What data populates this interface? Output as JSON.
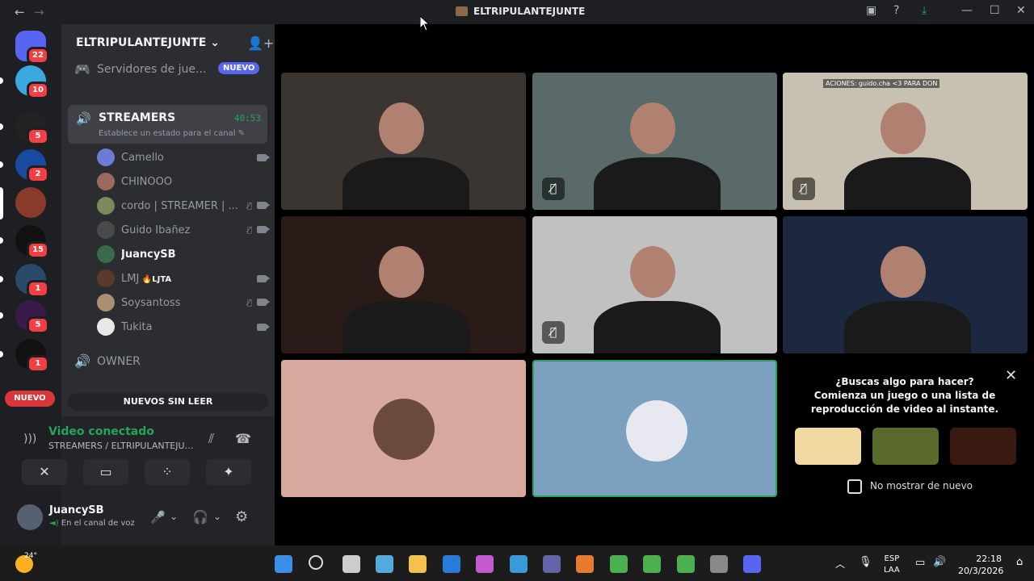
{
  "window": {
    "title": "ELTRIPULANTEJUNTE"
  },
  "rail": {
    "servers": [
      {
        "name": "discord-home",
        "badge": "22"
      },
      {
        "name": "server-2",
        "badge": "10"
      },
      {
        "name": "server-3",
        "badge": "5"
      },
      {
        "name": "server-4",
        "badge": "2"
      },
      {
        "name": "server-5",
        "badge": ""
      },
      {
        "name": "server-6",
        "badge": "15"
      },
      {
        "name": "server-7",
        "badge": "1"
      },
      {
        "name": "server-8",
        "badge": "5"
      },
      {
        "name": "server-9",
        "badge": "1"
      }
    ],
    "nuevo_label": "NUEVO"
  },
  "sidebar": {
    "guild_name": "ELTRIPULANTEJUNTE",
    "channel_servidores": "Servidores de jue...",
    "new_tag": "NUEVO",
    "active_channel": {
      "name": "STREAMERS",
      "timer": "40:53",
      "status": "Establece un estado para el canal"
    },
    "members": [
      {
        "name": "Camello",
        "tag": "",
        "muted": false,
        "video": true,
        "color": "#6b7bd6"
      },
      {
        "name": "CHINOOO",
        "tag": "",
        "muted": false,
        "video": false,
        "color": "#9a6b5d"
      },
      {
        "name": "cordo | STREAMER | ...",
        "tag": "",
        "muted": true,
        "video": true,
        "color": "#7a8a5a"
      },
      {
        "name": "Guido Ibañez",
        "tag": "",
        "muted": true,
        "video": true,
        "color": "#4a4a4a"
      },
      {
        "name": "JuancySB",
        "tag": "",
        "muted": false,
        "video": false,
        "color": "#3a6a4a"
      },
      {
        "name": "LMJ",
        "tag": "LJTA",
        "muted": false,
        "video": true,
        "color": "#5a3a2a"
      },
      {
        "name": "Soysantoss",
        "tag": "",
        "muted": true,
        "video": true,
        "color": "#a89070"
      },
      {
        "name": "Tukita",
        "tag": "",
        "muted": false,
        "video": true,
        "color": "#e8e8e8"
      }
    ],
    "channel_owner": "OWNER",
    "unread_label": "NUEVOS SIN LEER"
  },
  "voice": {
    "connected": "Video conectado",
    "location": "STREAMERS / ELTRIPULANTEJUN..."
  },
  "user": {
    "name": "JuancySB",
    "status": "En el canal de voz"
  },
  "tiles": [
    {
      "name": "video-tile-1",
      "muted": false,
      "bg": "#3a3530"
    },
    {
      "name": "video-tile-2",
      "muted": true,
      "bg": "#5a6a6a"
    },
    {
      "name": "video-tile-3",
      "muted": true,
      "bg": "#c8c0b0",
      "overlay": "ACIONES: guido.cha <3    PARA DON"
    },
    {
      "name": "video-tile-4",
      "muted": false,
      "bg": "#2a1a18"
    },
    {
      "name": "video-tile-5",
      "muted": true,
      "bg": "#c0c2c0"
    },
    {
      "name": "video-tile-6",
      "muted": false,
      "bg": "#1c2840"
    },
    {
      "name": "avatar-tile-1",
      "muted": false,
      "bg": "#d7a99e"
    },
    {
      "name": "avatar-tile-2",
      "muted": false,
      "bg": "#7ba0c0"
    }
  ],
  "activity": {
    "title": "¿Buscas algo para hacer? Comienza un juego o una lista de reproducción de video al instante.",
    "dont_show": "No mostrar de nuevo",
    "games": [
      {
        "name": "letter-league-game",
        "color": "#f0d8a0"
      },
      {
        "name": "adventure-game",
        "color": "#5a6a2a"
      },
      {
        "name": "scream-game",
        "color": "#3a1a10"
      }
    ]
  },
  "taskbar": {
    "weather": "24°",
    "lang_top": "ESP",
    "lang_bottom": "LAA",
    "time": "22:18",
    "date": "20/3/2026"
  }
}
